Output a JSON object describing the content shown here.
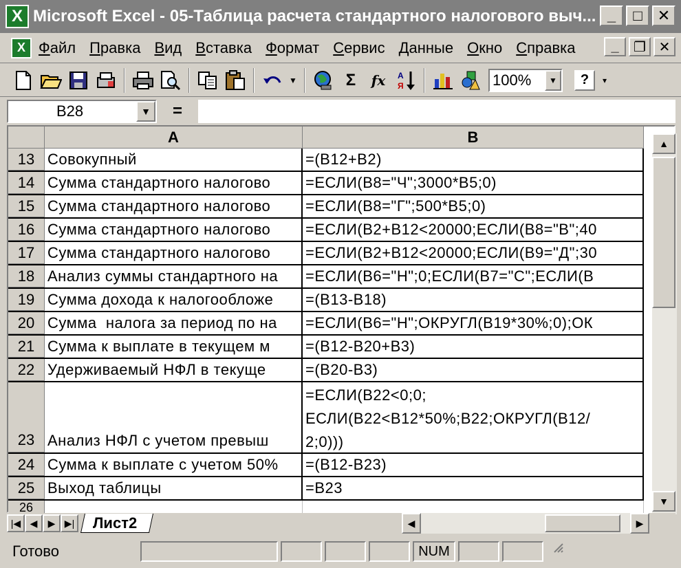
{
  "window": {
    "title": "Microsoft Excel - 05-Таблица расчета стандартного налогового выч...",
    "minimize": "_",
    "maximize": "□",
    "close": "✕",
    "app_icon": "X"
  },
  "menu": {
    "items": [
      "Файл",
      "Правка",
      "Вид",
      "Вставка",
      "Формат",
      "Сервис",
      "Данные",
      "Окно",
      "Справка"
    ],
    "doc_minimize": "_",
    "doc_restore": "❐",
    "doc_close": "✕"
  },
  "toolbar": {
    "icons": [
      "new-icon",
      "open-icon",
      "save-icon",
      "permission-icon",
      "print-icon",
      "print-preview-icon",
      "copy-icon",
      "paste-icon",
      "undo-icon",
      "globe-icon",
      "autosum-icon",
      "function-icon",
      "sort-icon",
      "chart-icon",
      "drawing-icon",
      "help-icon"
    ],
    "autosum": "Σ",
    "function": "fx",
    "zoom": "100%",
    "help": "?"
  },
  "formula_bar": {
    "name_box": "B28",
    "equals": "=",
    "formula": ""
  },
  "columns": [
    "A",
    "B"
  ],
  "rows": [
    {
      "num": "13",
      "a": "Совокупный",
      "b": "=(B12+B2)"
    },
    {
      "num": "14",
      "a": "Сумма стандартного налогово",
      "b": "=ЕСЛИ(B8=\"Ч\";3000*B5;0)"
    },
    {
      "num": "15",
      "a": "Сумма стандартного налогово",
      "b": "=ЕСЛИ(B8=\"Г\";500*B5;0)"
    },
    {
      "num": "16",
      "a": "Сумма стандартного налогово",
      "b": "=ЕСЛИ(B2+B12<20000;ЕСЛИ(B8=\"В\";40"
    },
    {
      "num": "17",
      "a": "Сумма стандартного налогово",
      "b": "=ЕСЛИ(B2+B12<20000;ЕСЛИ(B9=\"Д\";30"
    },
    {
      "num": "18",
      "a": "Анализ суммы стандартного на",
      "b": "=ЕСЛИ(B6=\"Н\";0;ЕСЛИ(B7=\"С\";ЕСЛИ(B"
    },
    {
      "num": "19",
      "a": "Сумма дохода к налогообложе",
      "b": "=(B13-B18)"
    },
    {
      "num": "20",
      "a": "Сумма  налога за период по на",
      "b": "=ЕСЛИ(B6=\"Н\";ОКРУГЛ(B19*30%;0);ОК"
    },
    {
      "num": "21",
      "a": "Сумма к выплате в текущем м",
      "b": "=(B12-B20+B3)"
    },
    {
      "num": "22",
      "a": "Удерживаемый НФЛ в текуще",
      "b": "=(B20-B3)"
    },
    {
      "num": "23",
      "a": "Анализ НФЛ с учетом превыш",
      "b": "=ЕСЛИ(B22<0;0;\nЕСЛИ(B22<B12*50%;B22;ОКРУГЛ(B12/\n2;0)))"
    },
    {
      "num": "24",
      "a": "Сумма к выплате с учетом 50%",
      "b": "=(B12-B23)"
    },
    {
      "num": "25",
      "a": "Выход таблицы",
      "b": "=B23"
    },
    {
      "num": "26",
      "a": "",
      "b": ""
    }
  ],
  "sheet_tab": "Лист2",
  "status": {
    "ready": "Готово",
    "num": "NUM"
  }
}
